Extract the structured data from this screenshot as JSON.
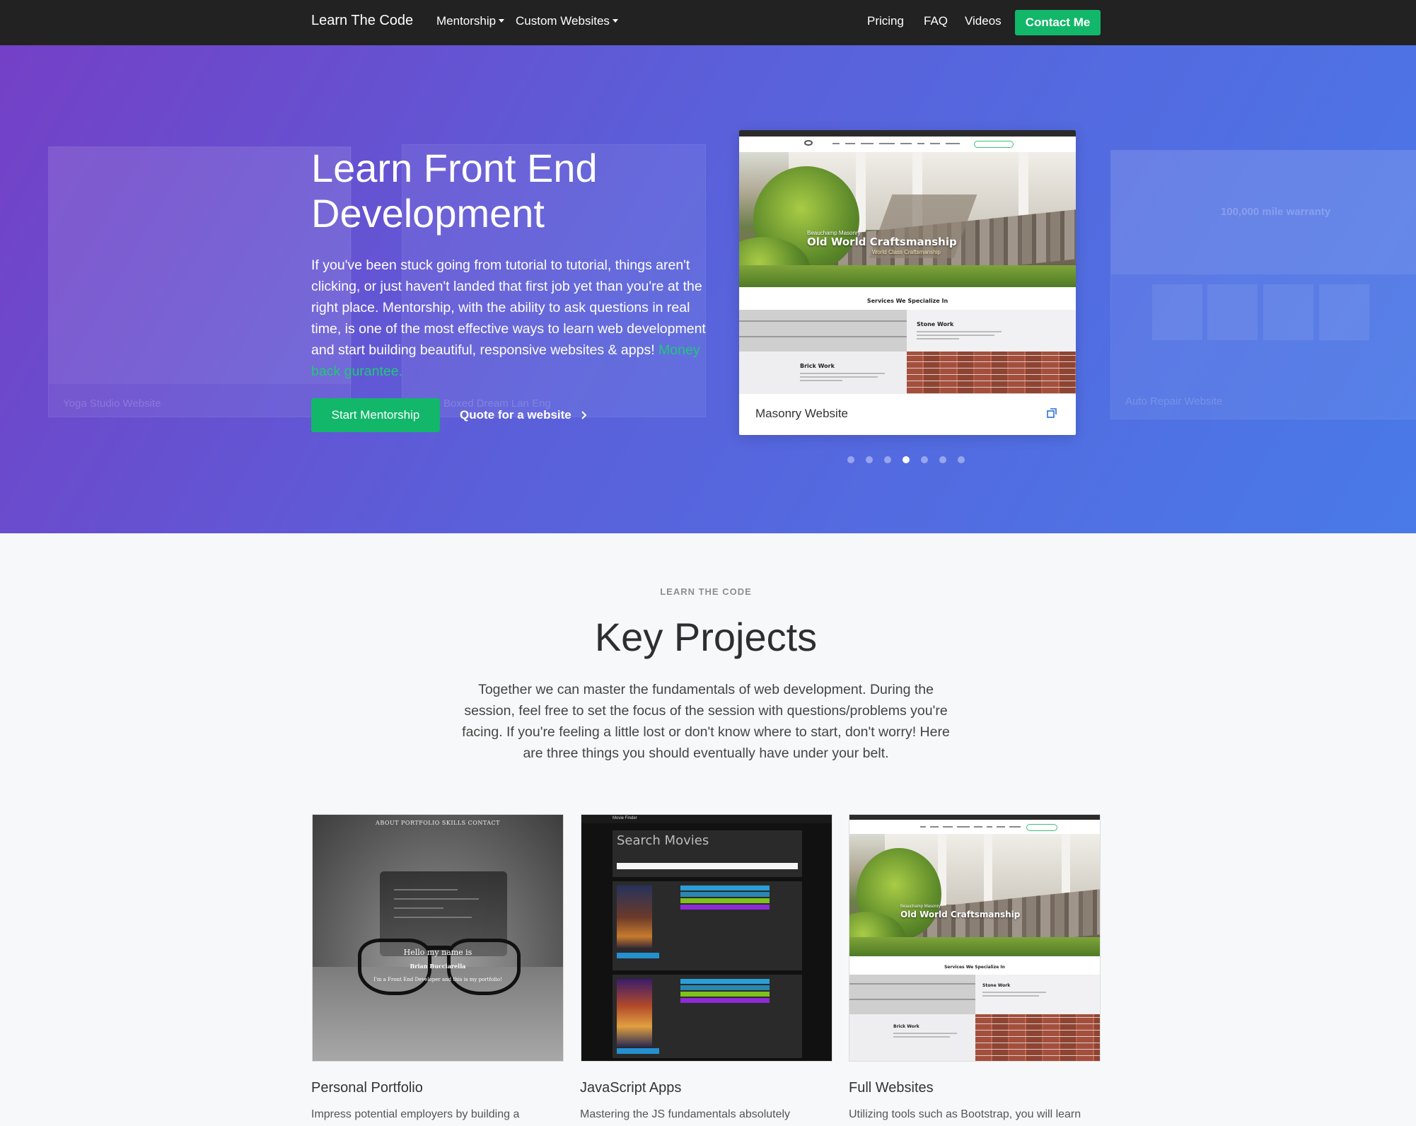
{
  "nav": {
    "brand": "Learn The Code",
    "mentorship": "Mentorship",
    "custom_websites": "Custom Websites",
    "pricing": "Pricing",
    "faq": "FAQ",
    "videos": "Videos",
    "contact": "Contact Me"
  },
  "hero": {
    "title": "Learn Front End Development",
    "text": "If you've been stuck going from tutorial to tutorial, things aren't clicking, or just haven't landed that first job yet than you're at the right place. Mentorship, with the ability to ask questions in real time, is one of the most effective ways to learn web development and start building beautiful, responsive websites & apps!",
    "money_back": "Money back gurantee.",
    "btn_mentorship": "Start Mentorship",
    "btn_quote": "Quote for a website",
    "ghost_left_caption": "Yoga Studio Website",
    "ghost_mid_caption": "Boxed Dream Lan Eng",
    "ghost_right_caption": "Auto Repair Website",
    "ghost_right_heading": "100,000 mile warranty"
  },
  "carousel": {
    "caption": "Masonry Website",
    "active_index": 3,
    "slide_count": 7,
    "shot": {
      "title": "Old World Craftsmanship",
      "kicker": "Beauchamp Masonry",
      "sub": "World Class Craftsmanship",
      "services": "Services We Specialize In",
      "stone": "Stone Work",
      "brick": "Brick Work"
    }
  },
  "section": {
    "eyebrow": "LEARN THE CODE",
    "title": "Key Projects",
    "text": "Together we can master the fundamentals of web development. During the session, feel free to set the focus of the session with questions/problems you're facing. If you're feeling a little lost or don't know where to start, don't worry! Here are three things you should eventually have under your belt."
  },
  "projects": [
    {
      "title": "Personal Portfolio",
      "text": "Impress potential employers by building a",
      "nav": "ABOUT  PORTFOLIO  SKILLS  CONTACT",
      "hello": "Hello my name is",
      "name": "Brian Bucciarella",
      "tagline": "I'm a Front End Developer and this is my portfolio!"
    },
    {
      "title": "JavaScript Apps",
      "text": "Mastering the JS fundamentals absolutely",
      "app_name": "Movie Finder",
      "search_title": "Search Movies"
    },
    {
      "title": "Full Websites",
      "text": "Utilizing tools such as Bootstrap, you will learn"
    }
  ],
  "colors": {
    "accent_green": "#12b76a",
    "navbar": "#222222",
    "hero_gradient_start": "#7440c6",
    "hero_gradient_end": "#497ae8"
  }
}
